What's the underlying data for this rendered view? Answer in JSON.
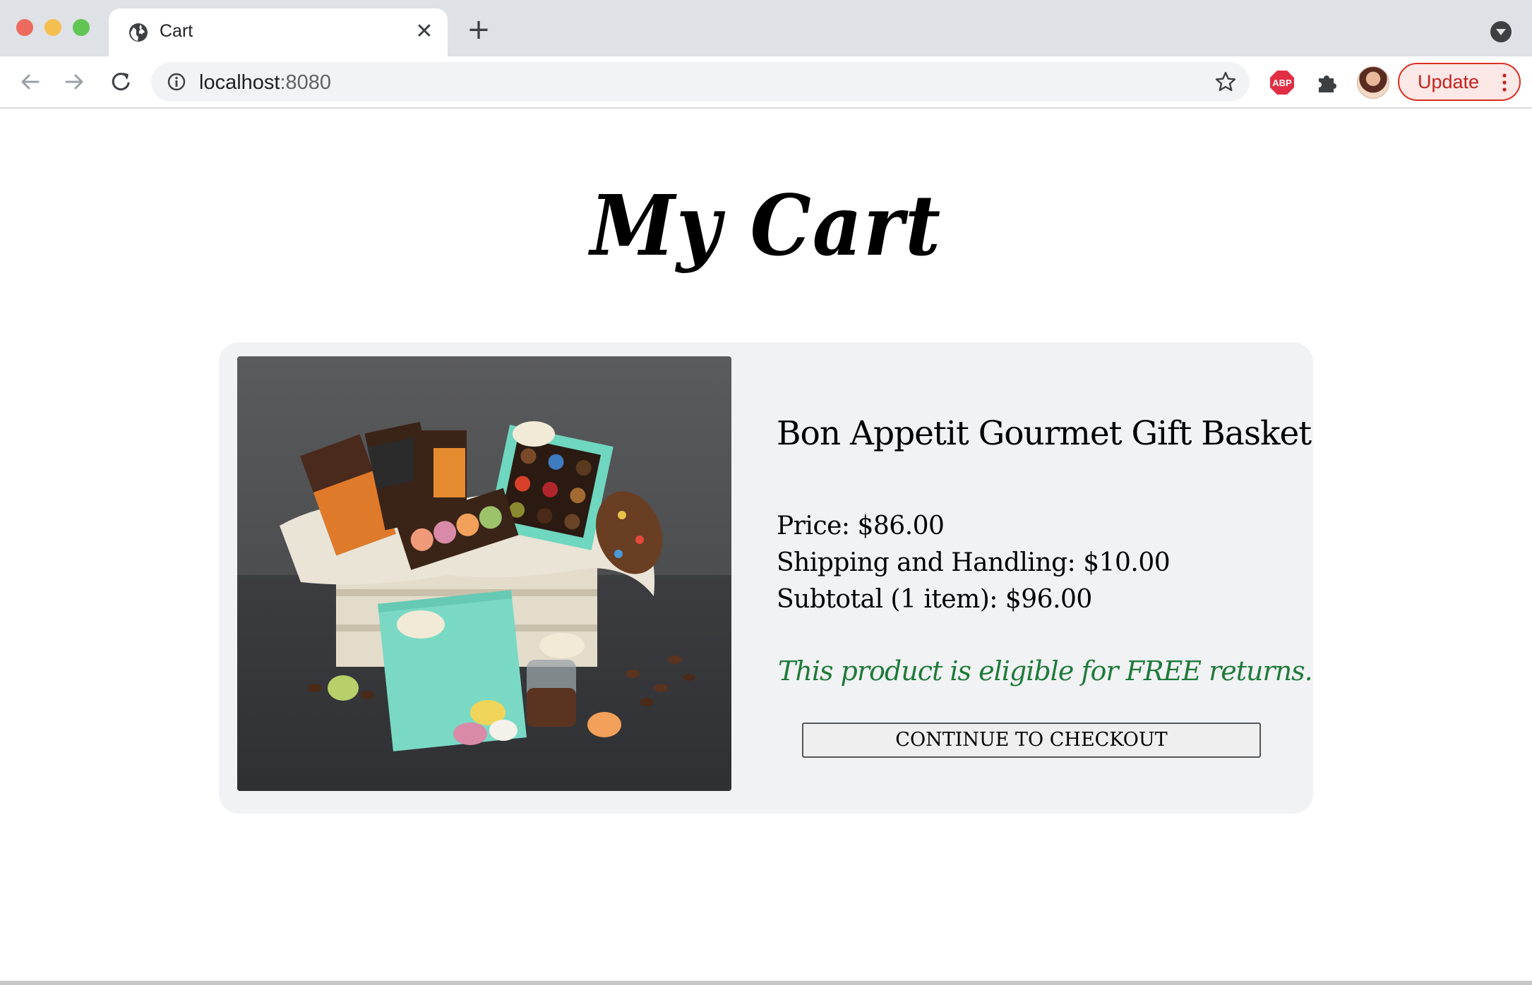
{
  "browser": {
    "tab": {
      "title": "Cart",
      "icon": "globe-icon",
      "close_icon": "close-icon"
    },
    "new_tab_icon": "plus-icon",
    "tab_search_icon": "chevron-down-icon",
    "address_bar": {
      "host": "localhost",
      "port": ":8080",
      "info_icon": "info-icon",
      "bookmark_icon": "star-icon"
    },
    "extensions": [
      "adblock-plus-icon",
      "puzzle-extensions-icon"
    ],
    "update_button": {
      "label": "Update",
      "menu_icon": "kebab-menu-icon"
    },
    "colors": {
      "tab_strip": "#dee1e6",
      "update_accent": "#d93025"
    }
  },
  "page": {
    "title": "My Cart",
    "cart_item": {
      "image": "chocolate-gift-basket-photo",
      "name": "Bon Appetit Gourmet Gift Basket",
      "price": "Price: $86.00",
      "shipping": "Shipping and Handling: $10.00",
      "subtotal": "Subtotal (1 item): $96.00",
      "returns_note": "This product is eligible for FREE returns.",
      "checkout_label": "CONTINUE TO CHECKOUT"
    },
    "colors": {
      "card_bg": "#f1f2f4",
      "returns_note": "#1f7a3a"
    }
  }
}
